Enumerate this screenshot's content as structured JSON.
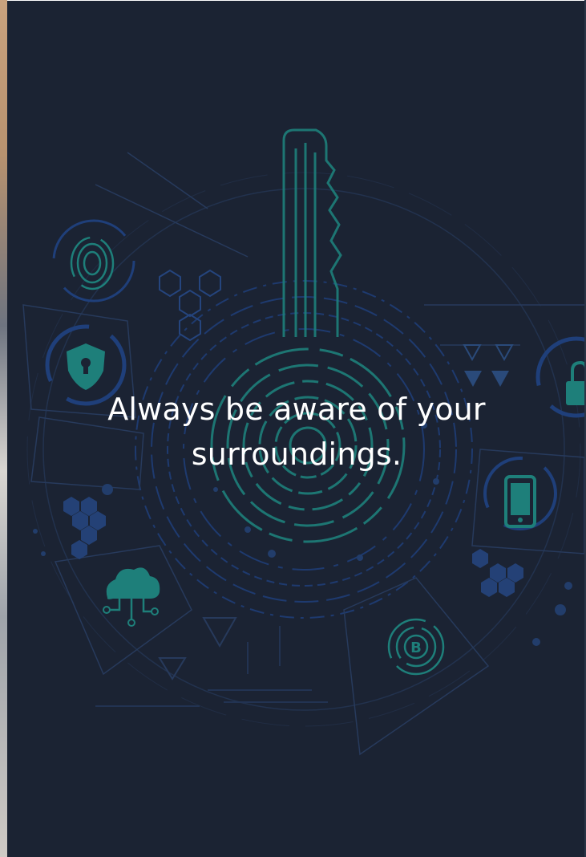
{
  "banner": {
    "headline_line1": "Always be aware of your",
    "headline_line2": "surroundings."
  },
  "colors": {
    "background": "#1b2333",
    "accent_teal": "#1e7f7a",
    "accent_blue": "#1f3f7a",
    "text": "#ffffff"
  },
  "icons": [
    "key-icon",
    "fingerprint-icon",
    "shield-lock-icon",
    "cloud-network-icon",
    "smartphone-icon",
    "bitcoin-icon",
    "padlock-icon",
    "hexagon-cluster-icon"
  ]
}
